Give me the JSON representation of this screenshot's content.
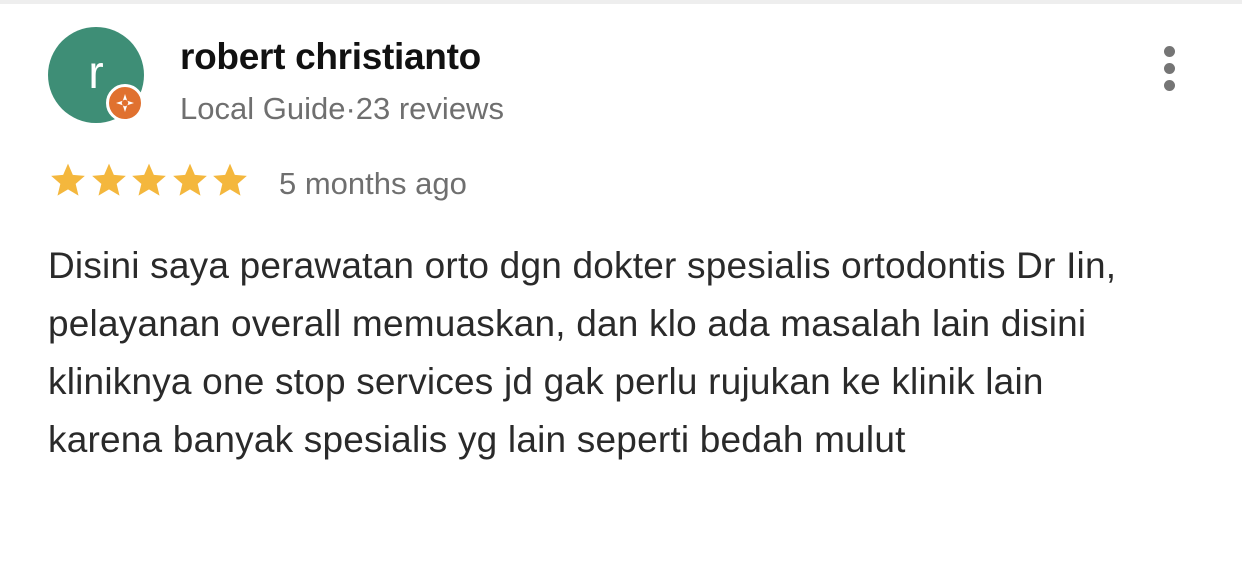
{
  "review": {
    "author": {
      "initial": "r",
      "name": "robert christianto",
      "meta": "Local Guide·23 reviews",
      "avatar_color": "#3e8e76",
      "badge_icon": "local-guide-badge-icon",
      "badge_color": "#e0712f"
    },
    "rating": {
      "stars": 5,
      "max": 5,
      "star_color": "#f4b73d"
    },
    "time": "5 months ago",
    "text": "Disini saya perawatan orto dgn dokter spesialis ortodontis Dr Iin, pelayanan overall memuaskan, dan klo ada masalah lain disini kliniknya one stop services jd gak perlu rujukan ke klinik lain karena banyak spesialis yg lain seperti bedah mulut",
    "more_icon": "more-vert-icon"
  }
}
